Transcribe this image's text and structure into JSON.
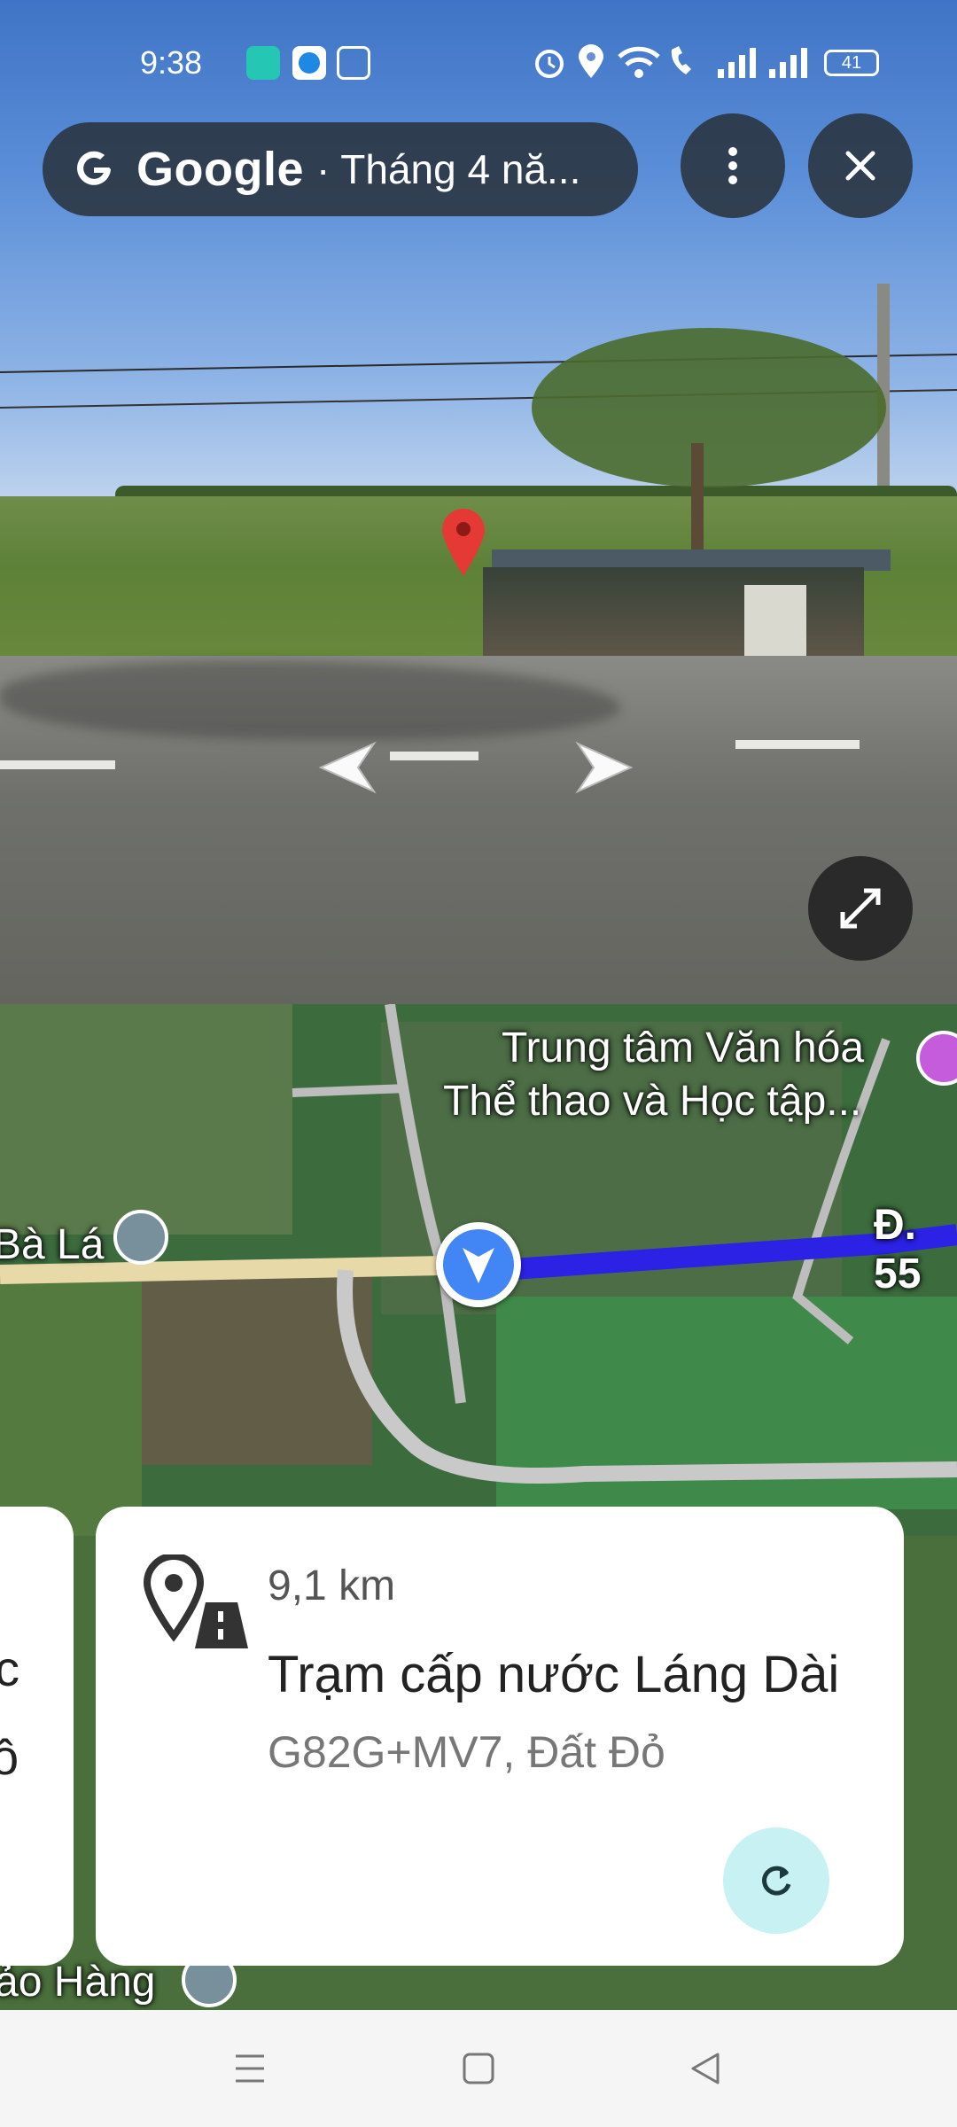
{
  "status_bar": {
    "time": "9:38",
    "battery": "41"
  },
  "street_view": {
    "brand": "Google",
    "date_label": "· Tháng 4 nă...",
    "menu_icon": "more-vertical-icon",
    "close_icon": "close-icon",
    "expand_icon": "expand-icon"
  },
  "map": {
    "label_center_line1": "Trung tâm Văn hóa",
    "label_center_line2": "Thể thao và Học tập...",
    "label_left": "Bà Lá",
    "label_road": "Đ. 55",
    "label_bottom": "ảo Hàng",
    "label_edge_1": "c",
    "label_edge_2": "ồ",
    "route_color": "#2b22e6"
  },
  "card": {
    "distance": "9,1 km",
    "place_name": "Trạm cấp nước Láng Dài",
    "address": "G82G+MV7, Đất Đỏ"
  },
  "colors": {
    "accent": "#4285f4",
    "refresh_bg": "#c8f1f4"
  }
}
